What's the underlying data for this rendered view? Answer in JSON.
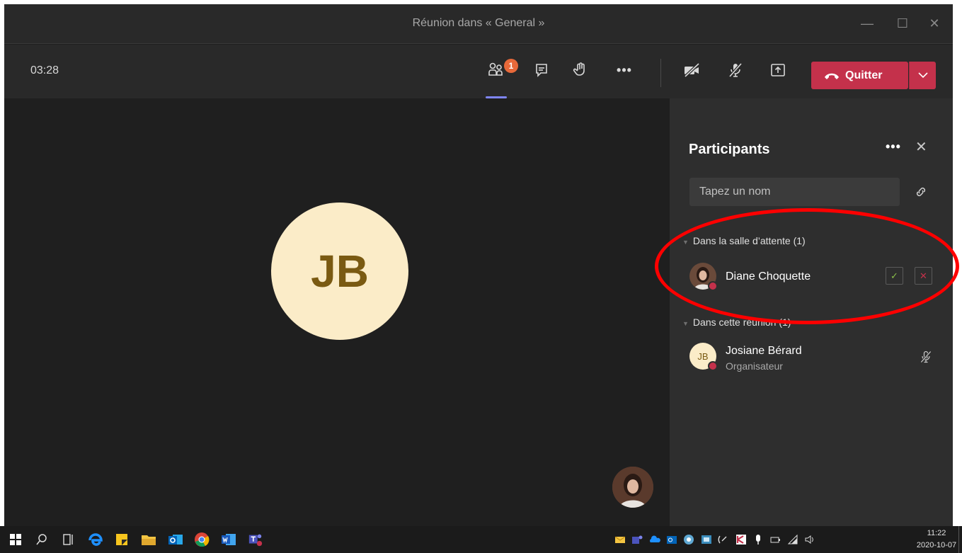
{
  "window": {
    "title": "Réunion dans « General »",
    "controls": {
      "minimize": "—",
      "maximize": "☐",
      "close": "✕"
    }
  },
  "toolbar": {
    "timer": "03:28",
    "participants_badge": "1",
    "quit_label": "Quitter",
    "icons": [
      "participants-icon",
      "chat-icon",
      "raise-hand-icon",
      "more-icon",
      "camera-off-icon",
      "mic-off-icon",
      "share-screen-icon",
      "phone-hangup-icon",
      "chevron-down-icon"
    ]
  },
  "stage": {
    "main_initials": "JB"
  },
  "panel": {
    "title": "Participants",
    "more_label": "•••",
    "close_label": "✕",
    "search_placeholder": "Tapez un nom",
    "lobby_header": "Dans la salle d’attente (1)",
    "lobby": [
      {
        "name": "Diane Choquette",
        "admit_label": "✓",
        "deny_label": "✕"
      }
    ],
    "meeting_header": "Dans cette réunion (1)",
    "meeting": [
      {
        "initials": "JB",
        "name": "Josiane Bérard",
        "role": "Organisateur"
      }
    ]
  },
  "taskbar": {
    "time": "11:22",
    "date": "2020-10-07"
  },
  "colors": {
    "accent": "#7f85f5",
    "quit": "#c4314b",
    "badge": "#e8693a",
    "avatar_bg": "#fbecc8",
    "highlight": "#ff0000"
  }
}
